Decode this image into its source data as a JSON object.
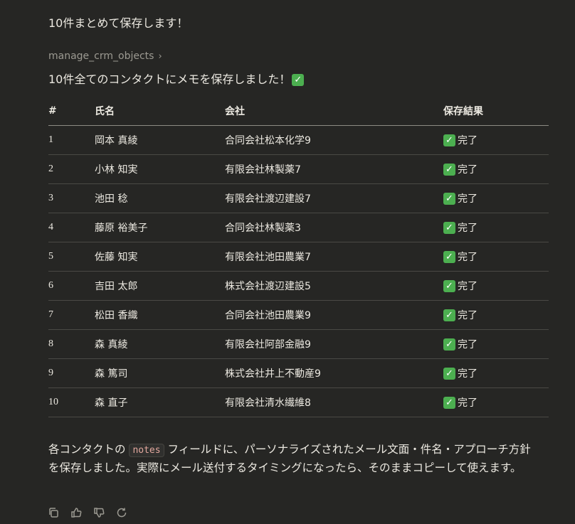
{
  "intro_text": "10件まとめて保存します！",
  "tool_call": {
    "label": "manage_crm_objects",
    "chevron": "›"
  },
  "summary_text": "10件全てのコンタクトにメモを保存しました！",
  "summary_icon": "check-mark-emoji",
  "table": {
    "headers": [
      "#",
      "氏名",
      "会社",
      "保存結果"
    ],
    "rows": [
      {
        "num": "1",
        "name": "岡本 真綾",
        "company": "合同会社松本化学9",
        "status": "完了"
      },
      {
        "num": "2",
        "name": "小林 知実",
        "company": "有限会社林製薬7",
        "status": "完了"
      },
      {
        "num": "3",
        "name": "池田 稔",
        "company": "有限会社渡辺建設7",
        "status": "完了"
      },
      {
        "num": "4",
        "name": "藤原 裕美子",
        "company": "合同会社林製薬3",
        "status": "完了"
      },
      {
        "num": "5",
        "name": "佐藤 知実",
        "company": "有限会社池田農業7",
        "status": "完了"
      },
      {
        "num": "6",
        "name": "吉田 太郎",
        "company": "株式会社渡辺建設5",
        "status": "完了"
      },
      {
        "num": "7",
        "name": "松田 香織",
        "company": "合同会社池田農業9",
        "status": "完了"
      },
      {
        "num": "8",
        "name": "森 真綾",
        "company": "有限会社阿部金融9",
        "status": "完了"
      },
      {
        "num": "9",
        "name": "森 篤司",
        "company": "株式会社井上不動産9",
        "status": "完了"
      },
      {
        "num": "10",
        "name": "森 直子",
        "company": "有限会社清水繊維8",
        "status": "完了"
      }
    ]
  },
  "closing": {
    "prefix": "各コンタクトの",
    "code": "notes",
    "suffix": "フィールドに、パーソナライズされたメール文面・件名・アプローチ方針を保存しました。実際にメール送付するタイミングになったら、そのままコピーして使えます。"
  },
  "actions": [
    "copy-icon",
    "thumbs-up-icon",
    "thumbs-down-icon",
    "retry-icon"
  ],
  "colors": {
    "background": "#262624",
    "text": "#ece9e1",
    "muted": "#9c9a92",
    "check_green": "#4caf50",
    "code_text": "#e3a89e"
  }
}
